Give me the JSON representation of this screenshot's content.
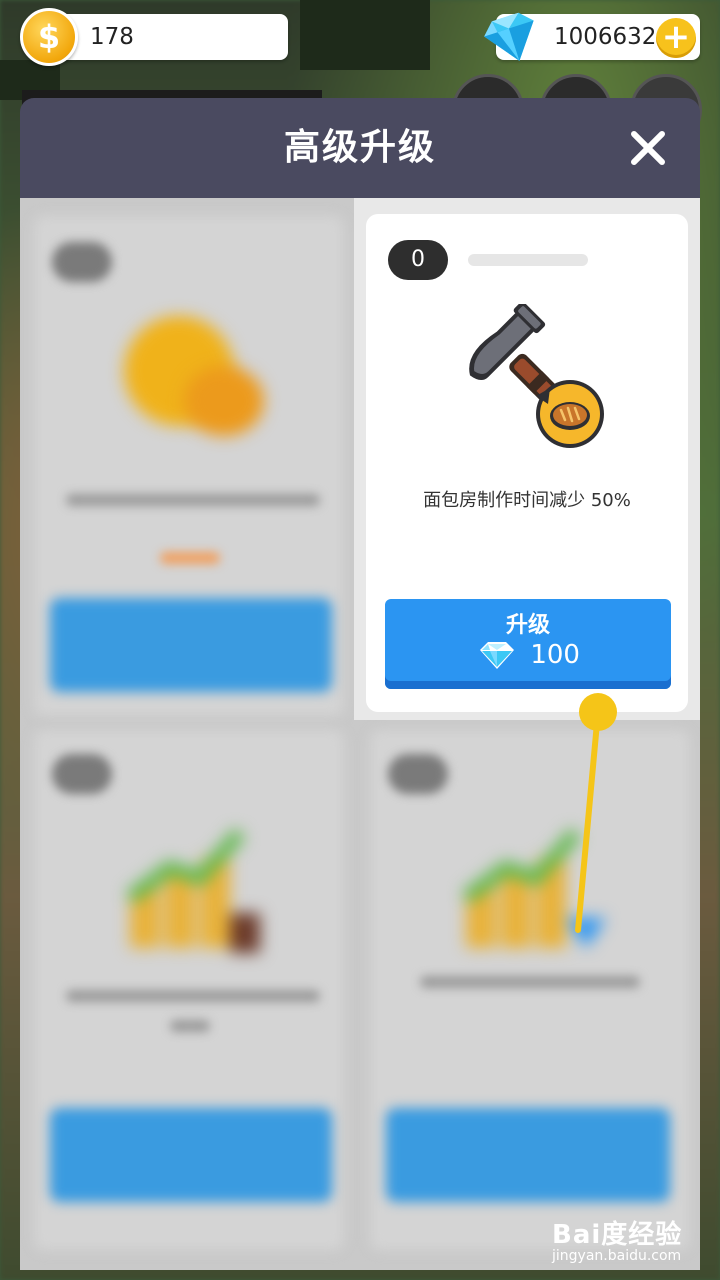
{
  "hud": {
    "coins": "178",
    "coin_symbol": "$",
    "gems": "1006632",
    "plus_symbol": "+"
  },
  "modal": {
    "title": "高级升级",
    "close_symbol": "✕"
  },
  "upgrade_card": {
    "level": "0",
    "progress_fraction": 0,
    "icon": "hammer-bread-icon",
    "description": "面包房制作时间减少 50%",
    "button_label": "升级",
    "cost": "100",
    "cost_icon": "diamond-icon"
  },
  "watermark": {
    "brand": "Bai度经验",
    "sub": "jingyan.baidu.com"
  },
  "colors": {
    "accent_blue": "#2b95f2",
    "header_bg": "#4a4a60",
    "gold": "#f7c21c",
    "pointer": "#f5c518"
  }
}
